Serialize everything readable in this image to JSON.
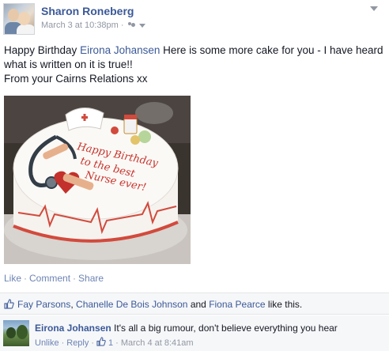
{
  "post": {
    "author": "Sharon Roneberg",
    "timestamp": "March 3 at 10:38pm",
    "separator": "·",
    "message": {
      "before": "Happy Birthday ",
      "tagged": "Eirona Johansen",
      "after": " Here is some more cake for you - I have heard what is written on it is true!!",
      "line2": "From your Cairns Relations xx"
    },
    "photo": {
      "cake_text": [
        "Happy Birthday",
        "to the best",
        "Nurse ever!"
      ]
    },
    "icons": {
      "privacy": "friends-icon",
      "menu": "chevron-down-icon"
    }
  },
  "actions": {
    "like": "Like",
    "comment": "Comment",
    "share": "Share",
    "sep": "·"
  },
  "likes": {
    "names": [
      "Fay Parsons",
      "Chanelle De Bois Johnson",
      "Fiona Pearce"
    ],
    "comma": ",",
    "and": "and",
    "suffix": "like this."
  },
  "comment": {
    "author": "Eirona Johansen",
    "text": "It's all a big rumour, don't believe everything you hear",
    "unlike": "Unlike",
    "reply": "Reply",
    "like_count": "1",
    "timestamp": "March 4 at 8:41am",
    "sep": "·"
  },
  "colors": {
    "link_blue": "#3b5998",
    "muted": "#9197a3",
    "background": "#ffffff",
    "panel": "#f6f7f9"
  }
}
